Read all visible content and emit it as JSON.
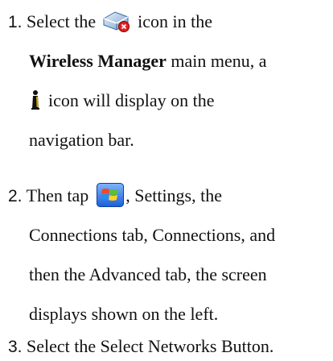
{
  "steps": [
    {
      "number": "1.",
      "line1_before": "Select the",
      "line1_after": "icon in the",
      "line2_bold": "Wireless Manager",
      "line2_after": " main menu, a",
      "line3_after": "icon will display on the",
      "line4": "navigation bar."
    },
    {
      "number": "2.",
      "line1_before": "Then tap",
      "line1_after": ", Settings, the",
      "line2": "Connections tab, Connections, and",
      "line3": "then the Advanced tab, the screen",
      "line4": "displays shown on the left."
    },
    {
      "number": "3.",
      "line1": "Select the Select Networks Button."
    }
  ],
  "icons": {
    "wireless_manager": "wireless-manager-icon",
    "navigation": "connection-status-icon",
    "start": "windows-start-icon"
  }
}
